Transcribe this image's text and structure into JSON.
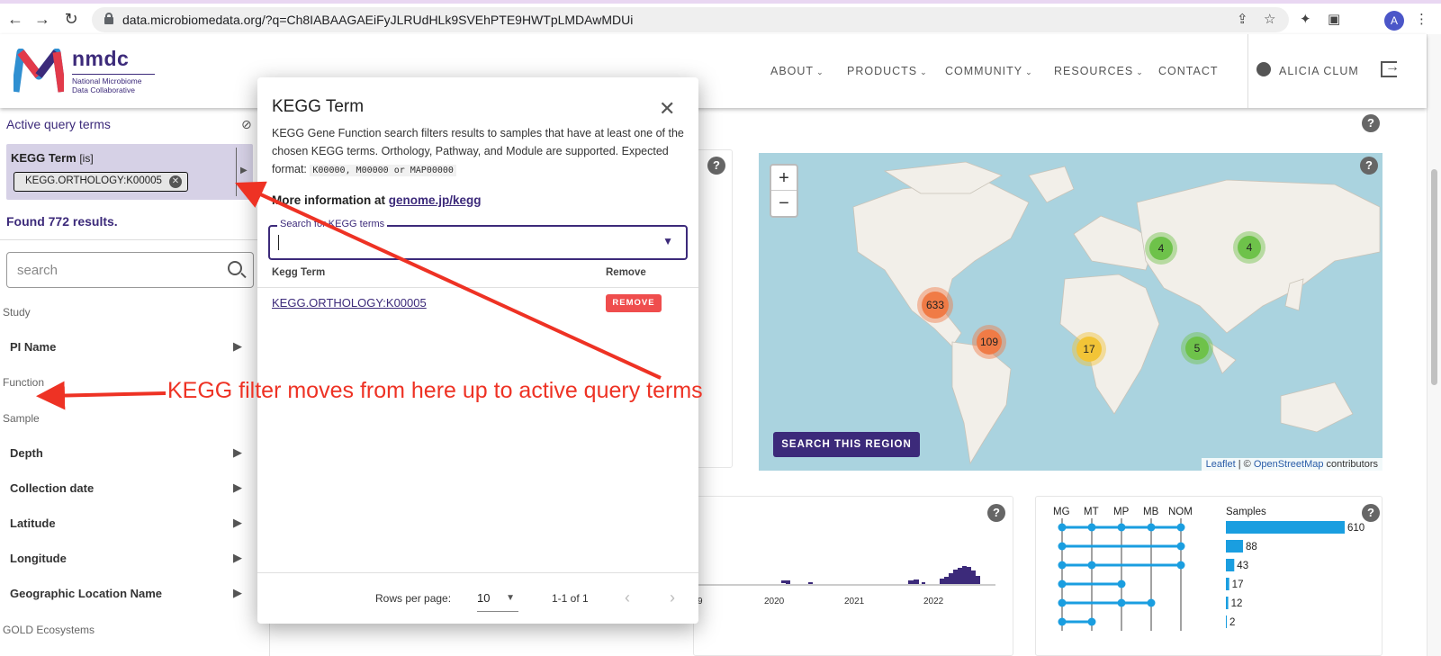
{
  "browser": {
    "url": "data.microbiomedata.org/?q=Ch8IABAAGAEiFyJLRUdHLk9SVEhPTE9HWTpLMDAwMDUi",
    "profile_initial": "A"
  },
  "header": {
    "logo_text": "nmdc",
    "logo_subtitle": "National Microbiome Data Collaborative",
    "menu": [
      {
        "label": "ABOUT"
      },
      {
        "label": "PRODUCTS"
      },
      {
        "label": "COMMUNITY"
      },
      {
        "label": "RESOURCES"
      },
      {
        "label": "CONTACT"
      }
    ],
    "user_name": "ALICIA CLUM"
  },
  "sidebar": {
    "active_title": "Active query terms",
    "query_term": {
      "field": "KEGG Term",
      "operator": "[is]",
      "value": "KEGG.ORTHOLOGY:K00005"
    },
    "found": "Found 772 results.",
    "search_placeholder": "search",
    "sections": {
      "study": "Study",
      "function": "Function",
      "sample": "Sample",
      "gold": "GOLD Ecosystems"
    },
    "study_items": [
      "PI Name"
    ],
    "sample_items": [
      "Depth",
      "Collection date",
      "Latitude",
      "Longitude",
      "Geographic Location Name"
    ]
  },
  "map": {
    "zoom_in": "+",
    "zoom_out": "−",
    "clusters": [
      {
        "count": "633",
        "color": "#f07b46"
      },
      {
        "count": "109",
        "color": "#f07b46"
      },
      {
        "count": "17",
        "color": "#f2c437"
      },
      {
        "count": "5",
        "color": "#6ec24a"
      },
      {
        "count": "4",
        "color": "#6ec24a"
      },
      {
        "count": "4",
        "color": "#6ec24a"
      }
    ],
    "search_region": "SEARCH THIS REGION",
    "attribution_leaflet": "Leaflet",
    "attribution_sep": " | © ",
    "attribution_osm": "OpenStreetMap",
    "attribution_tail": " contributors"
  },
  "modal": {
    "title": "KEGG Term",
    "description": "KEGG Gene Function search filters results to samples that have at least one of the chosen KEGG terms. Orthology, Pathway, and Module are supported. Expected format:",
    "format_code": "K00000, M00000 or MAP00000",
    "more_info_prefix": "More information at ",
    "more_info_link": "genome.jp/kegg",
    "search_label": "Search for KEGG terms",
    "col_term": "Kegg Term",
    "col_remove": "Remove",
    "row_term": "KEGG.ORTHOLOGY:K00005",
    "remove_label": "REMOVE",
    "rows_per_page_label": "Rows per page:",
    "rows_per_page_value": "10",
    "page_range": "1-1 of 1"
  },
  "annotation": {
    "text": "KEGG filter moves from here up to active query terms",
    "color": "#ee3224"
  },
  "timeline": {
    "ticks": [
      "9",
      "2020",
      "2021",
      "2022"
    ]
  },
  "upset": {
    "columns": [
      "MG",
      "MT",
      "MP",
      "MB",
      "NOM"
    ],
    "bar_header": "Samples",
    "bar_color": "#1a9ee0"
  },
  "chart_data": {
    "type": "bar",
    "title": "",
    "ylabel": "Samples",
    "categories": [
      "MG MT MP MB NOM",
      "MG NOM",
      "MG MT NOM",
      "MG MP",
      "MG MP MB",
      "MG MT"
    ],
    "values": [
      610,
      88,
      43,
      17,
      12,
      2
    ]
  }
}
